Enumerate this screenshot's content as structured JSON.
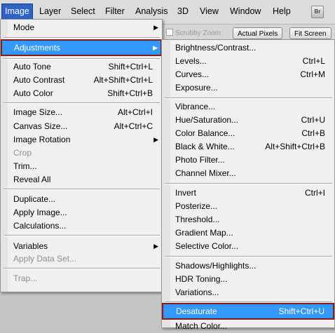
{
  "menubar": {
    "items": [
      "Image",
      "Layer",
      "Select",
      "Filter",
      "Analysis",
      "3D",
      "View",
      "Window",
      "Help"
    ],
    "br_label": "Br"
  },
  "options": {
    "scrubby_zoom": "Scrubby Zoom",
    "actual_pixels": "Actual Pixels",
    "fit_screen": "Fit Screen"
  },
  "image_menu": {
    "items": [
      {
        "label": "Mode",
        "shortcut": "",
        "submenu": true
      },
      {
        "label": "Adjustments",
        "shortcut": "",
        "submenu": true
      },
      {
        "label": "Auto Tone",
        "shortcut": "Shift+Ctrl+L"
      },
      {
        "label": "Auto Contrast",
        "shortcut": "Alt+Shift+Ctrl+L"
      },
      {
        "label": "Auto Color",
        "shortcut": "Shift+Ctrl+B"
      },
      {
        "label": "Image Size...",
        "shortcut": "Alt+Ctrl+I"
      },
      {
        "label": "Canvas Size...",
        "shortcut": "Alt+Ctrl+C"
      },
      {
        "label": "Image Rotation",
        "shortcut": "",
        "submenu": true
      },
      {
        "label": "Crop",
        "shortcut": ""
      },
      {
        "label": "Trim...",
        "shortcut": ""
      },
      {
        "label": "Reveal All",
        "shortcut": ""
      },
      {
        "label": "Duplicate...",
        "shortcut": ""
      },
      {
        "label": "Apply Image...",
        "shortcut": ""
      },
      {
        "label": "Calculations...",
        "shortcut": ""
      },
      {
        "label": "Variables",
        "shortcut": "",
        "submenu": true
      },
      {
        "label": "Apply Data Set...",
        "shortcut": ""
      },
      {
        "label": "Trap...",
        "shortcut": ""
      }
    ]
  },
  "adjustments_menu": {
    "items": [
      {
        "label": "Brightness/Contrast...",
        "shortcut": ""
      },
      {
        "label": "Levels...",
        "shortcut": "Ctrl+L"
      },
      {
        "label": "Curves...",
        "shortcut": "Ctrl+M"
      },
      {
        "label": "Exposure...",
        "shortcut": ""
      },
      {
        "label": "Vibrance...",
        "shortcut": ""
      },
      {
        "label": "Hue/Saturation...",
        "shortcut": "Ctrl+U"
      },
      {
        "label": "Color Balance...",
        "shortcut": "Ctrl+B"
      },
      {
        "label": "Black & White...",
        "shortcut": "Alt+Shift+Ctrl+B"
      },
      {
        "label": "Photo Filter...",
        "shortcut": ""
      },
      {
        "label": "Channel Mixer...",
        "shortcut": ""
      },
      {
        "label": "Invert",
        "shortcut": "Ctrl+I"
      },
      {
        "label": "Posterize...",
        "shortcut": ""
      },
      {
        "label": "Threshold...",
        "shortcut": ""
      },
      {
        "label": "Gradient Map...",
        "shortcut": ""
      },
      {
        "label": "Selective Color...",
        "shortcut": ""
      },
      {
        "label": "Shadows/Highlights...",
        "shortcut": ""
      },
      {
        "label": "HDR Toning...",
        "shortcut": ""
      },
      {
        "label": "Variations...",
        "shortcut": ""
      },
      {
        "label": "Desaturate",
        "shortcut": "Shift+Ctrl+U"
      },
      {
        "label": "Match Color...",
        "shortcut": ""
      }
    ]
  },
  "colors": {
    "highlight": "#3399ff",
    "annotation_box": "#8b1a1a",
    "active_menu": "#2f62c4"
  }
}
